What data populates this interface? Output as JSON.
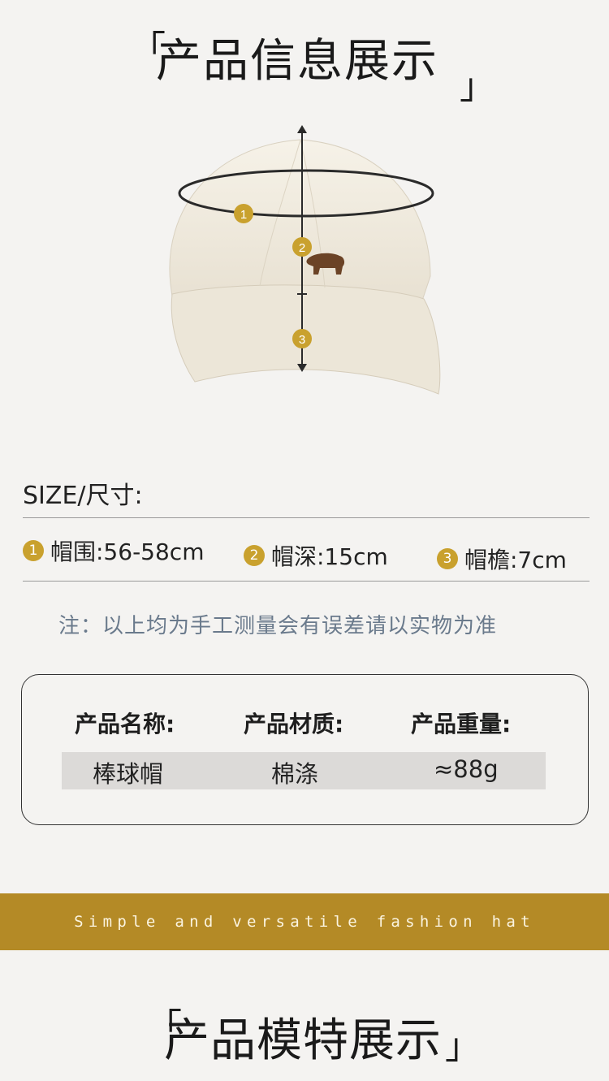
{
  "header": {
    "title": "产品信息展示",
    "bracket_open": "「",
    "bracket_close": "」"
  },
  "diagram": {
    "markers": [
      "1",
      "2",
      "3"
    ],
    "accent": "#c9a12e"
  },
  "size_section": {
    "label": "SIZE/尺寸:",
    "specs": [
      {
        "num": "1",
        "text": "帽围:56-58cm"
      },
      {
        "num": "2",
        "text": "帽深:15cm"
      },
      {
        "num": "3",
        "text": "帽檐:7cm"
      }
    ],
    "note": "注：以上均为手工测量会有误差请以实物为准"
  },
  "product_card": {
    "headers": [
      "产品名称:",
      "产品材质:",
      "产品重量:"
    ],
    "values": [
      "棒球帽",
      "棉涤",
      "≈88g"
    ]
  },
  "banner": {
    "text": "Simple and versatile fashion hat",
    "color": "#b48a26"
  },
  "footer": {
    "title": "产品模特展示",
    "bracket_open": "「",
    "bracket_close": "」"
  }
}
